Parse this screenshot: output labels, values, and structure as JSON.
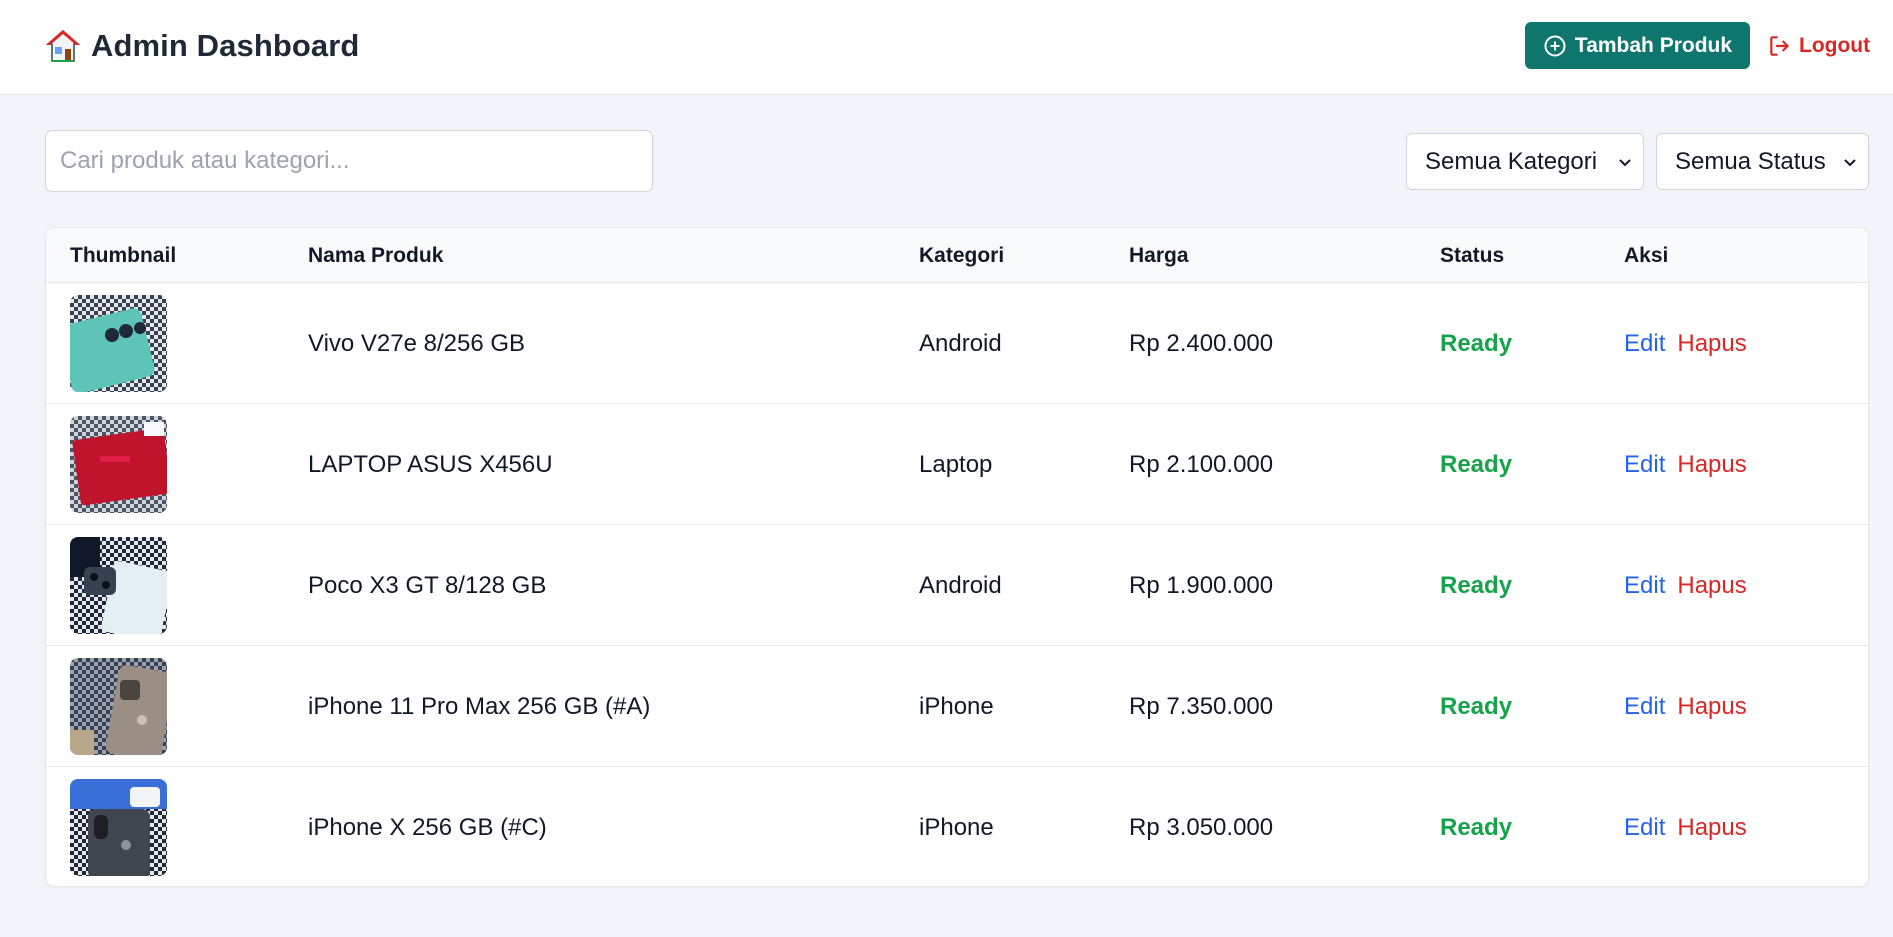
{
  "header": {
    "title": "Admin Dashboard",
    "brand_icon": "house-icon",
    "add_button": "Tambah Produk",
    "logout": "Logout",
    "accent": "#0f766e",
    "logout_color": "#dc2626"
  },
  "filters": {
    "search_placeholder": "Cari produk atau kategori...",
    "category_select": "Semua Kategori",
    "status_select": "Semua Status"
  },
  "table": {
    "headers": {
      "thumbnail": "Thumbnail",
      "name": "Nama Produk",
      "category": "Kategori",
      "price": "Harga",
      "status": "Status",
      "actions": "Aksi"
    },
    "edit_label": "Edit",
    "delete_label": "Hapus",
    "rows": [
      {
        "name": "Vivo V27e 8/256 GB",
        "category": "Android",
        "price": "Rp 2.400.000",
        "status": "Ready"
      },
      {
        "name": "LAPTOP ASUS X456U",
        "category": "Laptop",
        "price": "Rp 2.100.000",
        "status": "Ready"
      },
      {
        "name": "Poco X3 GT 8/128 GB",
        "category": "Android",
        "price": "Rp 1.900.000",
        "status": "Ready"
      },
      {
        "name": "iPhone 11 Pro Max 256 GB (#A)",
        "category": "iPhone",
        "price": "Rp 7.350.000",
        "status": "Ready"
      },
      {
        "name": "iPhone X 256 GB (#C)",
        "category": "iPhone",
        "price": "Rp 3.050.000",
        "status": "Ready"
      }
    ]
  },
  "colors": {
    "status_ready": "#16a34a",
    "edit": "#2563eb",
    "delete": "#dc2626"
  }
}
